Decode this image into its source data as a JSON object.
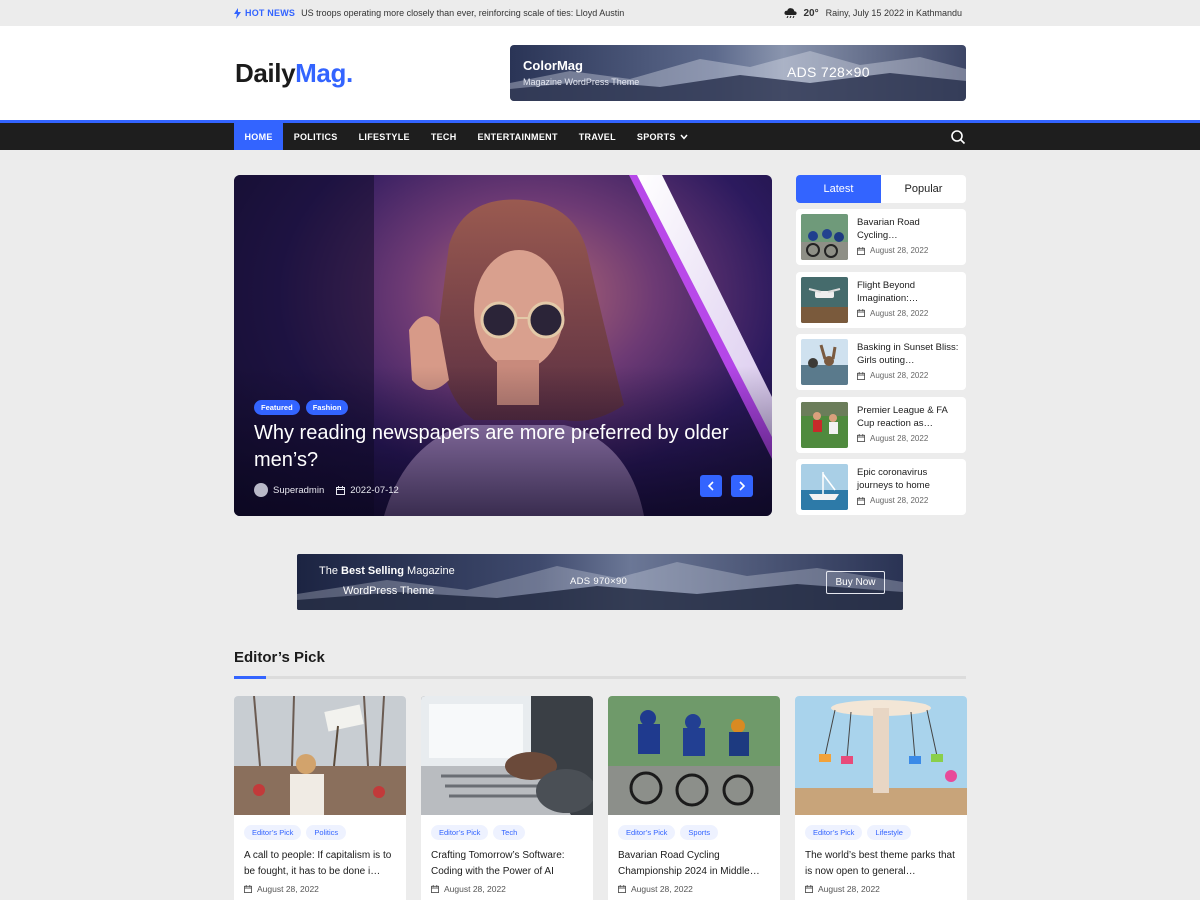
{
  "topbar": {
    "hot_label": "HOT NEWS",
    "hot_text": "US troops operating more closely than ever, reinforcing scale of ties: Lloyd Austin",
    "temperature": "20°",
    "weather_text": "Rainy, July 15 2022 in Kathmandu"
  },
  "header": {
    "logo_part1": "Daily",
    "logo_part2": "Mag.",
    "ad": {
      "brand": "ColorMag",
      "subtitle": "Magazine WordPress Theme",
      "size": "ADS 728×90"
    }
  },
  "nav": {
    "items": [
      {
        "label": "HOME"
      },
      {
        "label": "POLITICS"
      },
      {
        "label": "LIFESTYLE"
      },
      {
        "label": "TECH"
      },
      {
        "label": "ENTERTAINMENT"
      },
      {
        "label": "TRAVEL"
      },
      {
        "label": "SPORTS"
      }
    ]
  },
  "hero": {
    "tags": [
      "Featured",
      "Fashion"
    ],
    "title": "Why reading newspapers are more preferred by older men’s?",
    "author": "Superadmin",
    "date": "2022-07-12"
  },
  "sidebar": {
    "tabs": [
      "Latest",
      "Popular"
    ],
    "items": [
      {
        "title": "Bavarian Road Cycling…",
        "date": "August 28, 2022"
      },
      {
        "title": "Flight Beyond Imagination:…",
        "date": "August 28, 2022"
      },
      {
        "title": "Basking in Sunset Bliss: Girls outing…",
        "date": "August 28, 2022"
      },
      {
        "title": "Premier League & FA Cup reaction as…",
        "date": "August 28, 2022"
      },
      {
        "title": "Epic coronavirus journeys to home",
        "date": "August 28, 2022"
      }
    ]
  },
  "ad_banner": {
    "line1_pre": "The ",
    "line1_bold": "Best Selling",
    "line1_post": " Magazine",
    "line2": "WordPress Theme",
    "size": "ADS 970×90",
    "button": "Buy Now"
  },
  "editors_pick": {
    "title": "Editor’s Pick",
    "cards": [
      {
        "tags": [
          "Editor’s Pick",
          "Politics"
        ],
        "title": "A call to people: If capitalism is to be fought, it has to be done i…",
        "date": "August 28, 2022"
      },
      {
        "tags": [
          "Editor’s Pick",
          "Tech"
        ],
        "title": "Crafting Tomorrow’s Software: Coding with the Power of AI",
        "date": "August 28, 2022"
      },
      {
        "tags": [
          "Editor’s Pick",
          "Sports"
        ],
        "title": "Bavarian Road Cycling Championship 2024 in Middle…",
        "date": "August 28, 2022"
      },
      {
        "tags": [
          "Editor’s Pick",
          "Lifestyle"
        ],
        "title": "The world’s best theme parks that is now open to general…",
        "date": "August 28, 2022"
      }
    ]
  },
  "colors": {
    "accent": "#3364ff",
    "nav_bg": "#1e1e1e",
    "page_bg": "#ececec"
  }
}
